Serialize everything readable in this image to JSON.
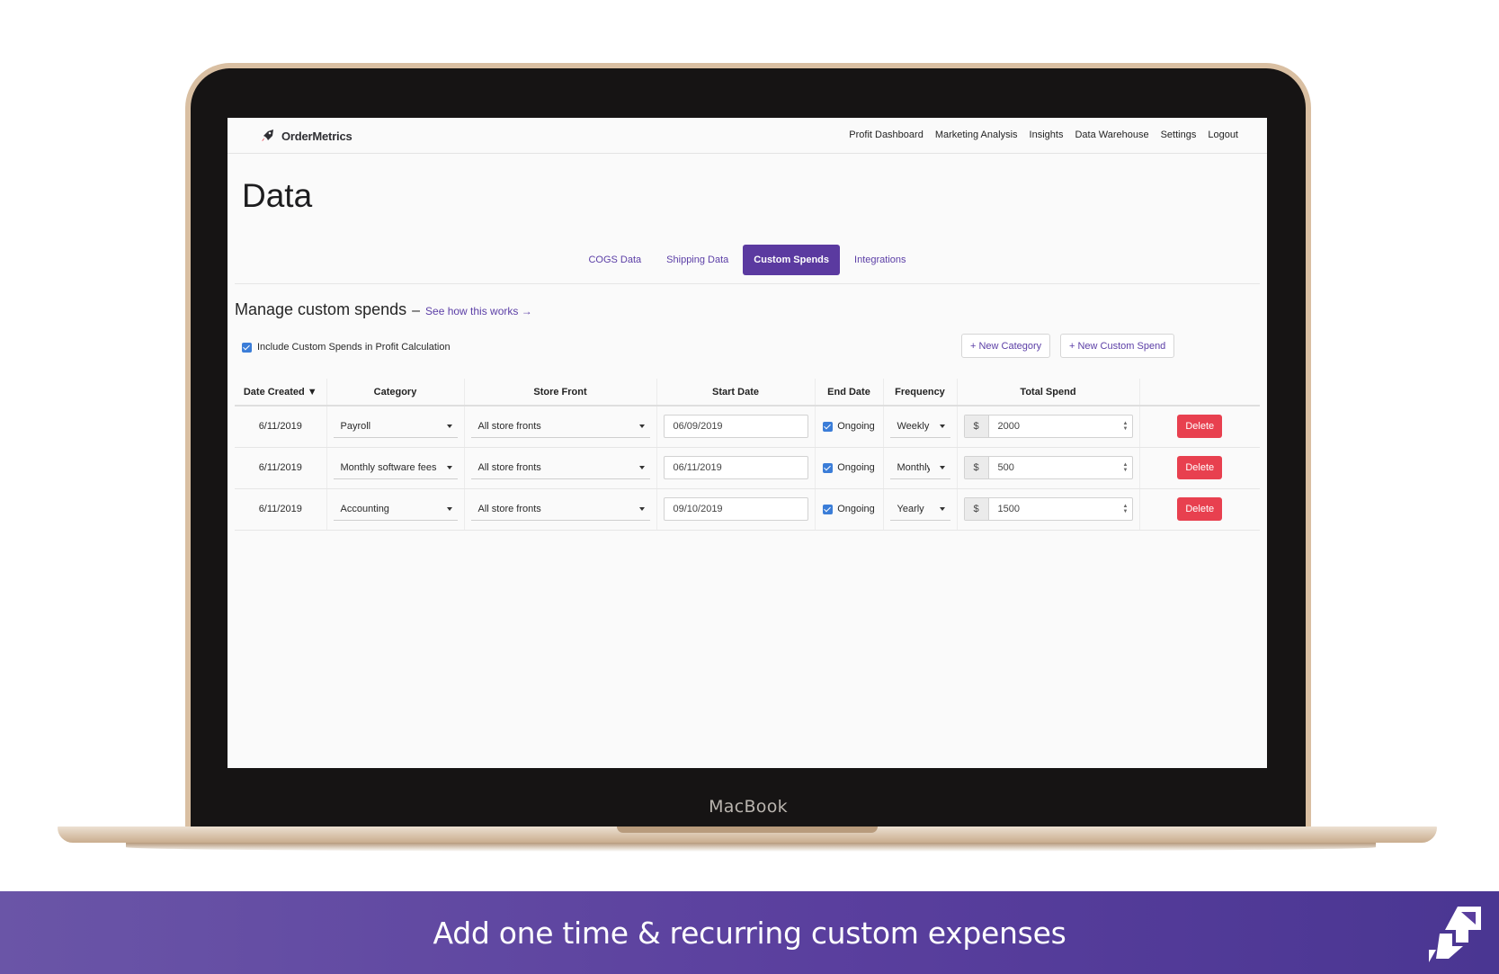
{
  "device": {
    "label": "MacBook"
  },
  "app": {
    "brand": "OrderMetrics"
  },
  "nav": [
    "Profit Dashboard",
    "Marketing Analysis",
    "Insights",
    "Data Warehouse",
    "Settings",
    "Logout"
  ],
  "page": {
    "title": "Data"
  },
  "tabs": [
    {
      "label": "COGS Data",
      "active": false
    },
    {
      "label": "Shipping Data",
      "active": false
    },
    {
      "label": "Custom Spends",
      "active": true
    },
    {
      "label": "Integrations",
      "active": false
    }
  ],
  "section": {
    "title": "Manage custom spends",
    "dash": "–",
    "link": "See how this works →",
    "include_checkbox": {
      "label": "Include Custom Spends in Profit Calculation",
      "checked": true
    },
    "new_category": "+ New Category",
    "new_custom_spend": "+ New Custom Spend"
  },
  "table": {
    "headers": [
      "Date Created ▼",
      "Category",
      "Store Front",
      "Start Date",
      "End Date",
      "Frequency",
      "Total Spend",
      ""
    ],
    "rows": [
      {
        "date_created": "6/11/2019",
        "category": "Payroll",
        "store_front": "All store fronts",
        "start_date": "06/09/2019",
        "end_date": "Ongoing",
        "ongoing_checked": true,
        "frequency": "Weekly",
        "currency": "$",
        "total_spend": "2000",
        "delete": "Delete"
      },
      {
        "date_created": "6/11/2019",
        "category": "Monthly software fees",
        "store_front": "All store fronts",
        "start_date": "06/11/2019",
        "end_date": "Ongoing",
        "ongoing_checked": true,
        "frequency": "Monthly",
        "currency": "$",
        "total_spend": "500",
        "delete": "Delete"
      },
      {
        "date_created": "6/11/2019",
        "category": "Accounting",
        "store_front": "All store fronts",
        "start_date": "09/10/2019",
        "end_date": "Ongoing",
        "ongoing_checked": true,
        "frequency": "Yearly",
        "currency": "$",
        "total_spend": "1500",
        "delete": "Delete"
      }
    ]
  },
  "banner": {
    "text": "Add one time & recurring custom expenses"
  },
  "colors": {
    "accent": "#5b3aa0",
    "danger": "#e8404f",
    "banner_start": "#6a55a7",
    "banner_end": "#4a3692"
  }
}
